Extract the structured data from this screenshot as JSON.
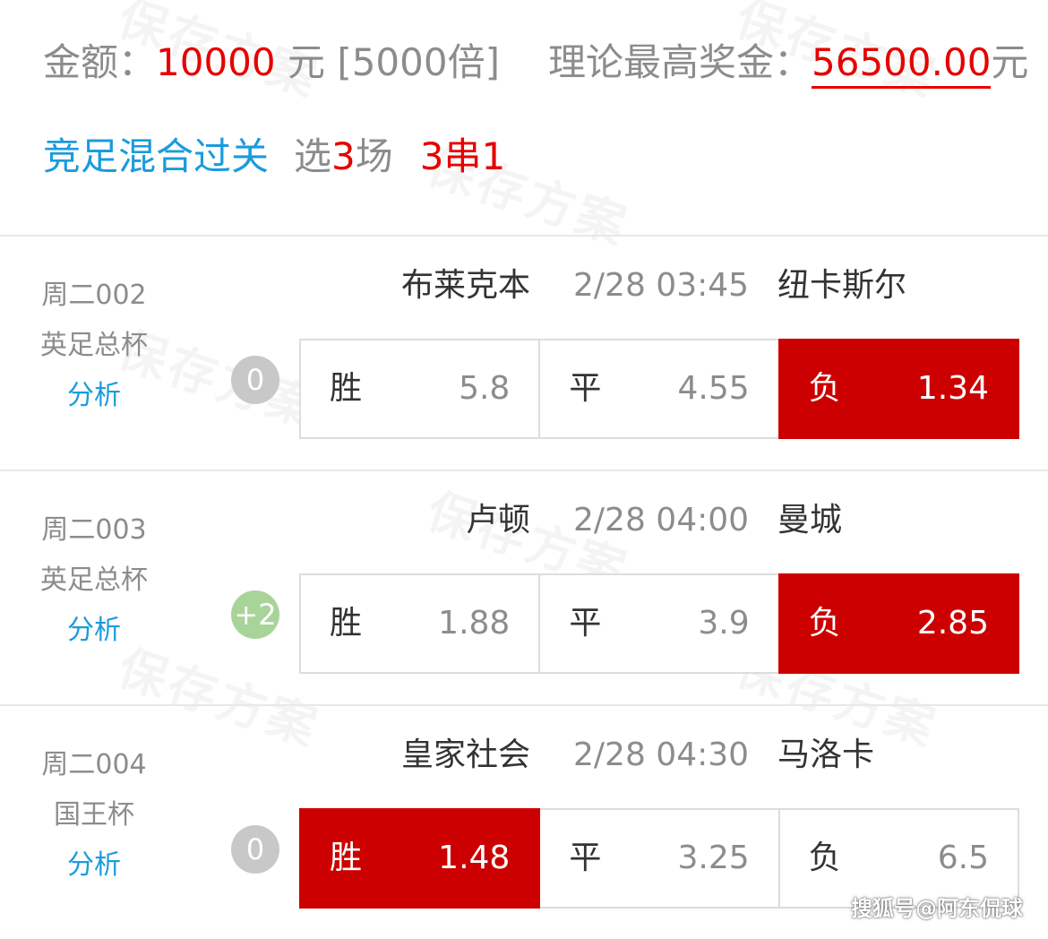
{
  "watermark": "保存方案",
  "summary": {
    "amount_label": "金额：",
    "amount": "10000",
    "amount_unit": " 元 [5000倍]",
    "prize_label": "理论最高奖金：",
    "prize": "56500.00",
    "prize_unit": "元"
  },
  "mode": {
    "type": "竞足混合过关",
    "pick_prefix": "选",
    "pick_count": "3",
    "pick_suffix": "场",
    "combo": "3串1"
  },
  "matches": [
    {
      "code": "周二002",
      "league": "英足总杯",
      "analysis": "分析",
      "home": "布莱克本",
      "time": "2/28 03:45",
      "away": "纽卡斯尔",
      "handicap": "0",
      "odds": [
        {
          "label": "胜",
          "value": "5.8",
          "selected": false
        },
        {
          "label": "平",
          "value": "4.55",
          "selected": false
        },
        {
          "label": "负",
          "value": "1.34",
          "selected": true
        }
      ]
    },
    {
      "code": "周二003",
      "league": "英足总杯",
      "analysis": "分析",
      "home": "卢顿",
      "time": "2/28 04:00",
      "away": "曼城",
      "handicap": "+2",
      "odds": [
        {
          "label": "胜",
          "value": "1.88",
          "selected": false
        },
        {
          "label": "平",
          "value": "3.9",
          "selected": false
        },
        {
          "label": "负",
          "value": "2.85",
          "selected": true
        }
      ]
    },
    {
      "code": "周二004",
      "league": "国王杯",
      "analysis": "分析",
      "home": "皇家社会",
      "time": "2/28 04:30",
      "away": "马洛卡",
      "handicap": "0",
      "odds": [
        {
          "label": "胜",
          "value": "1.48",
          "selected": true
        },
        {
          "label": "平",
          "value": "3.25",
          "selected": false
        },
        {
          "label": "负",
          "value": "6.5",
          "selected": false
        }
      ]
    }
  ],
  "source": "搜狐号@阿东侃球",
  "colors": {
    "accent_red": "#cc0000",
    "text_red": "#e60000",
    "link_blue": "#1a9bdc",
    "muted_gray": "#8c8c8c",
    "handicap_green": "#a8d49a",
    "handicap_gray": "#c8c8c8"
  }
}
